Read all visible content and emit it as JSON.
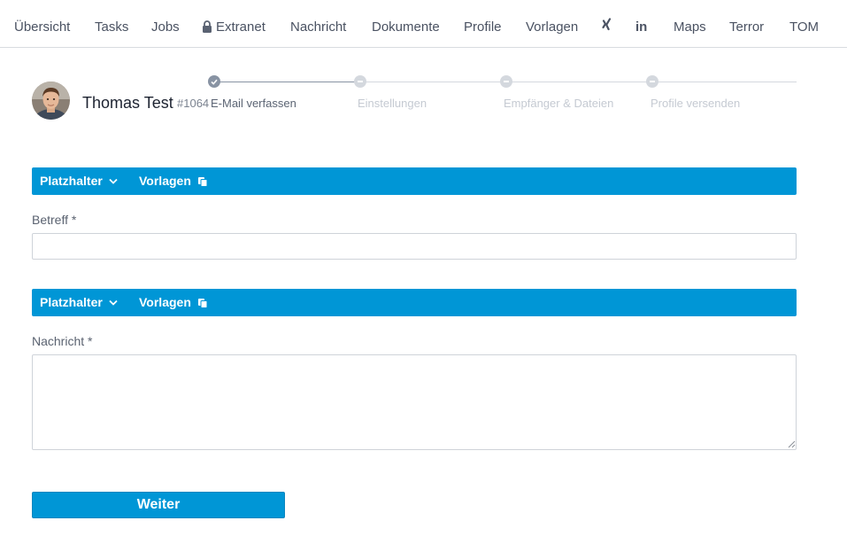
{
  "nav": {
    "items": [
      {
        "label": "Übersicht"
      },
      {
        "label": "Tasks"
      },
      {
        "label": "Jobs"
      },
      {
        "label": "Extranet",
        "icon": "lock-icon"
      },
      {
        "label": "Nachricht"
      },
      {
        "label": "Dokumente"
      },
      {
        "label": "Profile"
      },
      {
        "label": "Vorlagen"
      },
      {
        "label": "",
        "icon": "xing-icon"
      },
      {
        "label": "in",
        "icon": "linkedin-icon"
      },
      {
        "label": "Maps"
      },
      {
        "label": "Terror"
      },
      {
        "label": "TOM"
      }
    ]
  },
  "person": {
    "name": "Thomas Test",
    "id": "#1064"
  },
  "stepper": {
    "steps": [
      {
        "label": "E-Mail verfassen",
        "state": "done"
      },
      {
        "label": "Einstellungen",
        "state": "pending"
      },
      {
        "label": "Empfänger & Dateien",
        "state": "pending"
      },
      {
        "label": "Profile versenden",
        "state": "pending"
      }
    ]
  },
  "subject_section": {
    "toolbar": {
      "placeholder_label": "Platzhalter",
      "templates_label": "Vorlagen"
    },
    "label": "Betreff *",
    "value": ""
  },
  "message_section": {
    "toolbar": {
      "placeholder_label": "Platzhalter",
      "templates_label": "Vorlagen"
    },
    "label": "Nachricht *",
    "value": ""
  },
  "submit": {
    "label": "Weiter"
  },
  "colors": {
    "accent": "#0096d6",
    "step_done": "#8893a3",
    "step_pending": "#d4d8de"
  }
}
